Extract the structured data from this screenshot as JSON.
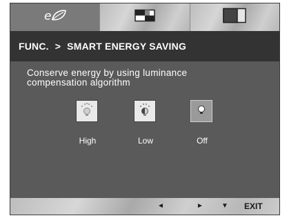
{
  "tabs": [
    {
      "icon": "eco-leaf-icon",
      "active": true
    },
    {
      "icon": "picture-settings-icon",
      "active": false
    },
    {
      "icon": "display-split-icon",
      "active": false
    }
  ],
  "breadcrumb": {
    "section": "FUNC.",
    "separator": ">",
    "page": "SMART ENERGY SAVING"
  },
  "description": {
    "line1": "Conserve energy by using luminance",
    "line2": "compensation algorithm"
  },
  "options": [
    {
      "label": "High",
      "icon": "bulb-high-icon",
      "selected": false
    },
    {
      "label": "Low",
      "icon": "bulb-low-icon",
      "selected": false
    },
    {
      "label": "Off",
      "icon": "bulb-off-icon",
      "selected": true
    }
  ],
  "nav": {
    "left": "◄",
    "right": "►",
    "down": "▼",
    "exit": "EXIT"
  }
}
